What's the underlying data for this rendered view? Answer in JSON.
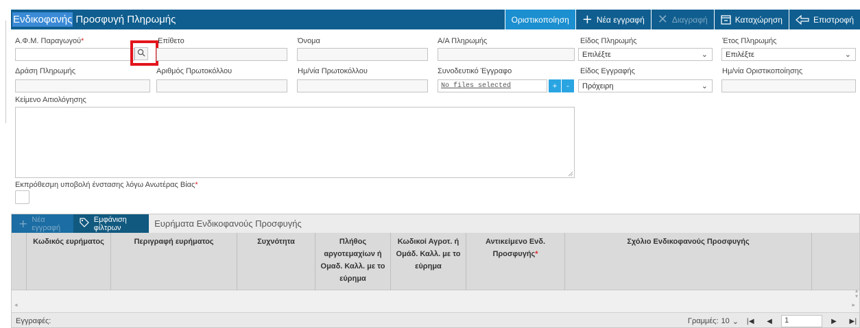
{
  "header": {
    "title_highlight": "Ενδικοφανής",
    "title_rest": "Προσφυγή Πληρωμής",
    "buttons": {
      "finalize": "Οριστικοποίηση",
      "new_record": "Νέα εγγραφή",
      "delete": "Διαγραφή",
      "save": "Καταχώρηση",
      "back": "Επιστροφή"
    }
  },
  "form": {
    "afm_label": "Α.Φ.Μ. Παραγωγού",
    "surname_label": "Επίθετο",
    "name_label": "Όνομα",
    "payment_aa_label": "Α/Α Πληρωμής",
    "payment_type_label": "Είδος Πληρωμής",
    "payment_type_value": "Επιλέξτε",
    "payment_year_label": "Έτος Πληρωμής",
    "payment_year_value": "Επιλέξτε",
    "payment_action_label": "Δράση Πληρωμής",
    "protocol_number_label": "Αριθμός Πρωτοκόλλου",
    "protocol_date_label": "Ημ/νία Πρωτοκόλλου",
    "attachment_label": "Συνοδευτικό Έγγραφο",
    "attachment_value": "No files selected",
    "attachment_add": "+",
    "attachment_remove": "-",
    "record_type_label": "Είδος Εγγραφής",
    "record_type_value": "Πρόχειρη",
    "finalize_date_label": "Ημ/νία Οριστικοποίησης",
    "justification_label": "Κείμενο Αιτιολόγησης",
    "late_submission_label": "Εκπρόθεσμη υποβολή ένστασης λόγω Ανωτέρας Βίας",
    "required_mark": "*"
  },
  "grid": {
    "new_record": "Νέα εγγραφή",
    "show_filters": "Εμφάνιση φίλτρων",
    "title": "Ευρήματα Ενδικοφανούς Προσφυγής",
    "columns": [
      "Κωδικός ευρήματος",
      "Περιγραφή ευρήματος",
      "Συχνότητα",
      "Πλήθος αργοτεμαχίων ή Ομαδ. Καλλ. με το εύρημα",
      "Κωδικοί Αγροτ. ή Ομάδ. Καλλ. με το εύρημα",
      "Αντικείμενο Ενδ. Προσφυγής",
      "Σχόλιο Ενδικοφανούς Προσφυγής"
    ],
    "records_label": "Εγγραφές:",
    "rows_label": "Γραμμές:",
    "rows_value": "10",
    "page_value": "1"
  },
  "colors": {
    "header_bg": "#0f5e8f",
    "header_accent": "#1b8fd0",
    "grid_toolbar": "#1b6da3",
    "required": "#d9242a",
    "highlight_box": "#e3141c"
  },
  "icons": [
    "plus-icon",
    "close-icon",
    "save-icon",
    "back-icon",
    "search-icon",
    "tag-icon",
    "chevron-down-icon"
  ]
}
